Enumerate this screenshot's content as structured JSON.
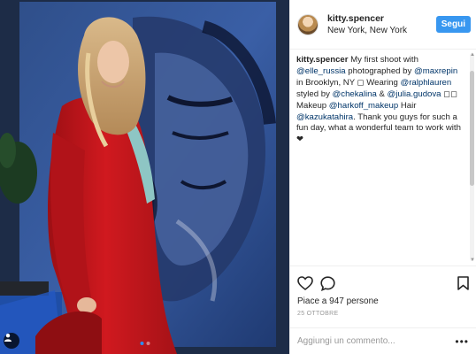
{
  "post": {
    "username": "kitty.spencer",
    "location": "New York, New York",
    "follow_label": "Segui",
    "caption": {
      "author": "kitty.spencer",
      "segments": [
        {
          "text": " My first shoot with "
        },
        {
          "text": "@elle_russia",
          "mention": true
        },
        {
          "text": " photographed by "
        },
        {
          "text": "@maxrepin",
          "mention": true
        },
        {
          "text": " in Brooklyn, NY ◻ Wearing "
        },
        {
          "text": "@ralphlauren",
          "mention": true
        },
        {
          "text": " styled by "
        },
        {
          "text": "@chekalina",
          "mention": true
        },
        {
          "text": " & "
        },
        {
          "text": "@julia.gudova",
          "mention": true
        },
        {
          "text": " ◻◻ Makeup "
        },
        {
          "text": "@harkoff_makeup",
          "mention": true
        },
        {
          "text": " Hair "
        },
        {
          "text": "@kazukatahira",
          "mention": true
        },
        {
          "text": ". Thank you guys for such a fun day, what a wonderful team to work with ❤"
        }
      ]
    },
    "likes": "Piace a 947 persone",
    "timestamp": "25 OTTOBRE",
    "comment_placeholder": "Aggiungi un commento...",
    "more_label": "•••",
    "carousel": {
      "count": 2,
      "active": 0
    }
  },
  "icons": {
    "like": "heart-icon",
    "comment": "comment-icon",
    "save": "bookmark-icon",
    "user_tags": "person-icon",
    "more": "more-dots-icon"
  },
  "colors": {
    "follow_button": "#3897f0",
    "mention": "#003569",
    "jacket": "#c8151c"
  }
}
